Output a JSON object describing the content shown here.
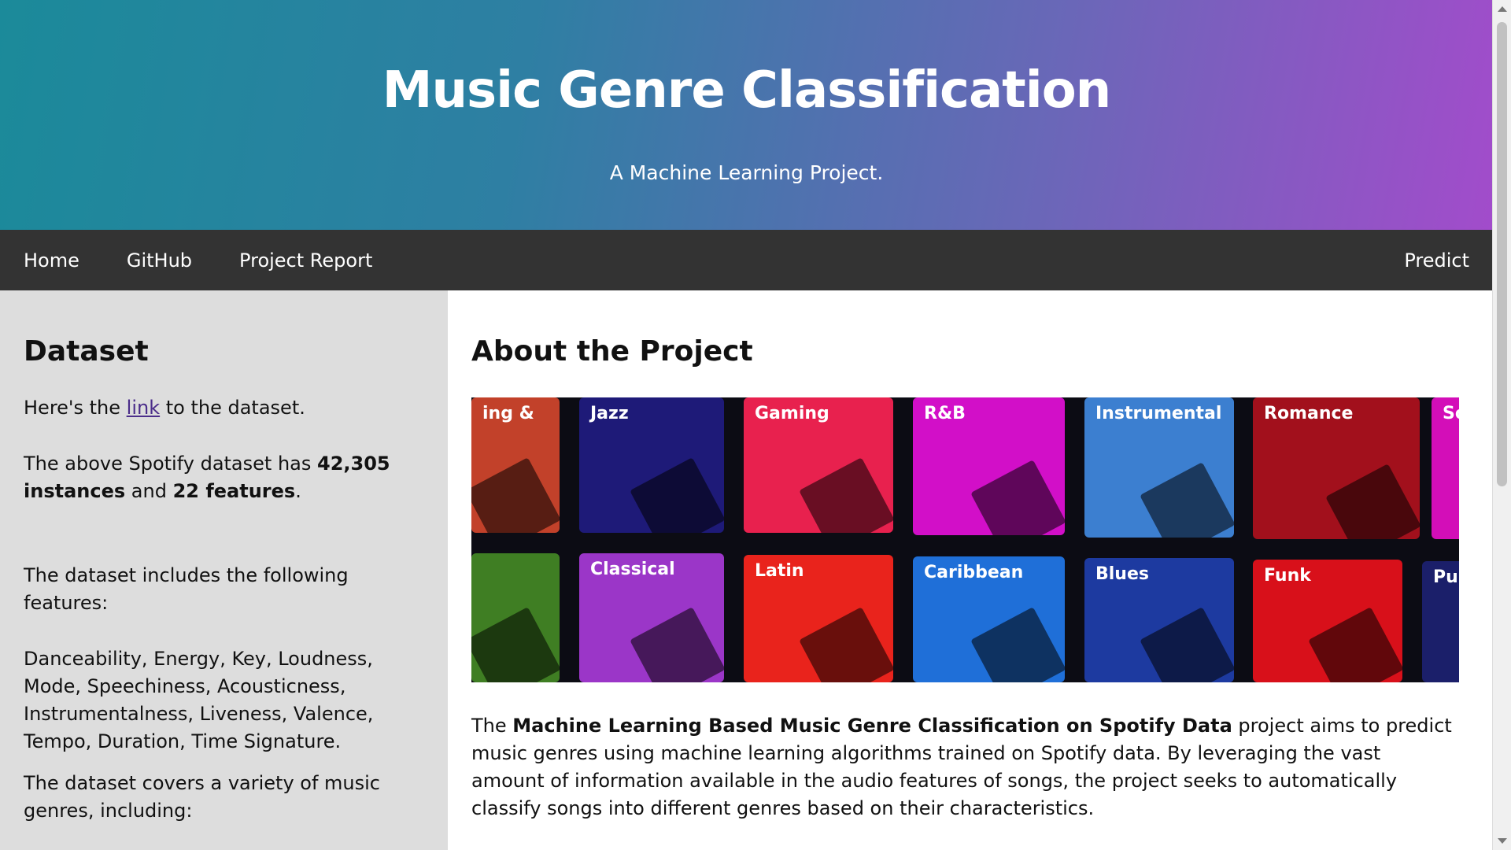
{
  "hero": {
    "title": "Music Genre Classification",
    "subtitle": "A Machine Learning Project."
  },
  "nav": {
    "home": "Home",
    "github": "GitHub",
    "report": "Project Report",
    "predict": "Predict"
  },
  "sidebar": {
    "heading": "Dataset",
    "link_pre": "Here's the ",
    "link_text": "link",
    "link_post": " to the dataset.",
    "stats_pre": "The above Spotify dataset has ",
    "stats_instances": "42,305 instances",
    "stats_mid": " and ",
    "stats_features": "22 features",
    "stats_post": ".",
    "features_intro": "The dataset includes the following features:",
    "features_list": "Danceability, Energy, Key, Loudness, Mode, Speechiness, Acousticness, Instrumentalness, Liveness, Valence, Tempo, Duration, Time Signature.",
    "genres_intro": "The dataset covers a variety of music genres, including:"
  },
  "main": {
    "heading": "About the Project",
    "banner_tiles": [
      "ing &",
      "Jazz",
      "Gaming",
      "R&B",
      "Instrumental",
      "Romance",
      "So",
      "",
      "Classical",
      "Latin",
      "Caribbean",
      "Blues",
      "Funk",
      "Pur"
    ],
    "desc_pre": "The ",
    "desc_bold": "Machine Learning Based Music Genre Classification on Spotify Data",
    "desc_post": " project aims to predict music genres using machine learning algorithms trained on Spotify data. By leveraging the vast amount of information available in the audio features of songs, the project seeks to automatically classify songs into different genres based on their characteristics."
  },
  "colors": {
    "nav_bg": "#333333",
    "sidebar_bg": "#dddddd",
    "gradient_start": "#1b8a9a",
    "gradient_end": "#a24ccb"
  }
}
